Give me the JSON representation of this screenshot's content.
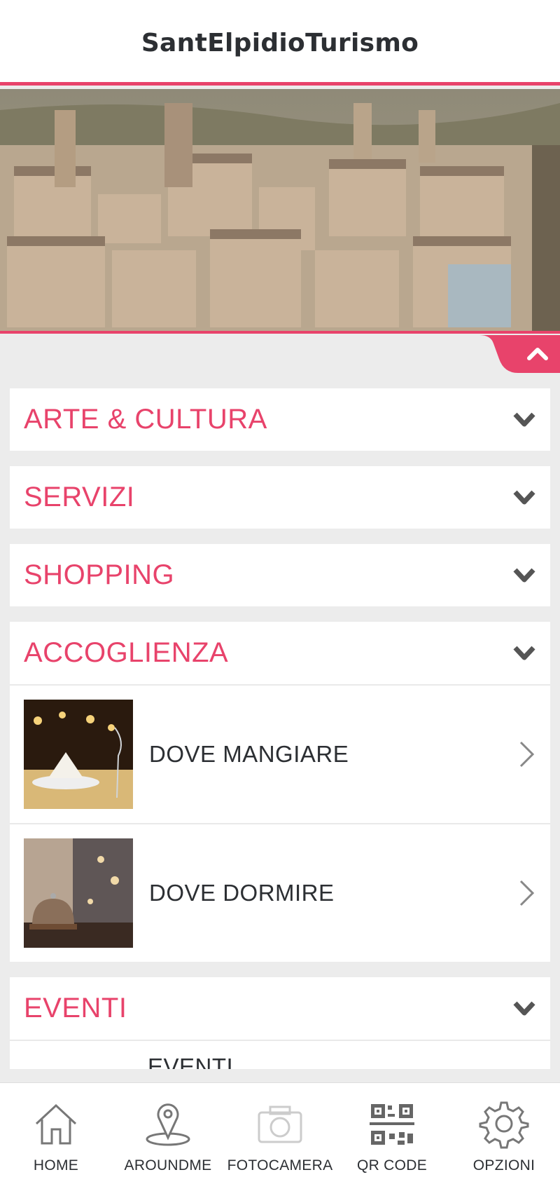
{
  "header": {
    "title": "SantElpidioTurismo"
  },
  "accent_color": "#e8436b",
  "sections": [
    {
      "title": "ARTE & CULTURA",
      "expanded": false
    },
    {
      "title": "SERVIZI",
      "expanded": false
    },
    {
      "title": "SHOPPING",
      "expanded": false
    },
    {
      "title": "ACCOGLIENZA",
      "expanded": true,
      "items": [
        {
          "label": "DOVE MANGIARE",
          "icon": "restaurant-photo"
        },
        {
          "label": "DOVE DORMIRE",
          "icon": "hotel-bell-photo"
        }
      ]
    },
    {
      "title": "EVENTI",
      "expanded": true,
      "items": [
        {
          "label": "EVENTI"
        }
      ]
    }
  ],
  "tabbar": {
    "items": [
      {
        "label": "HOME",
        "icon": "home-icon"
      },
      {
        "label": "AROUNDME",
        "icon": "location-pin-icon"
      },
      {
        "label": "FOTOCAMERA",
        "icon": "camera-icon"
      },
      {
        "label": "QR CODE",
        "icon": "qr-code-icon"
      },
      {
        "label": "OPZIONI",
        "icon": "gear-icon"
      }
    ]
  }
}
